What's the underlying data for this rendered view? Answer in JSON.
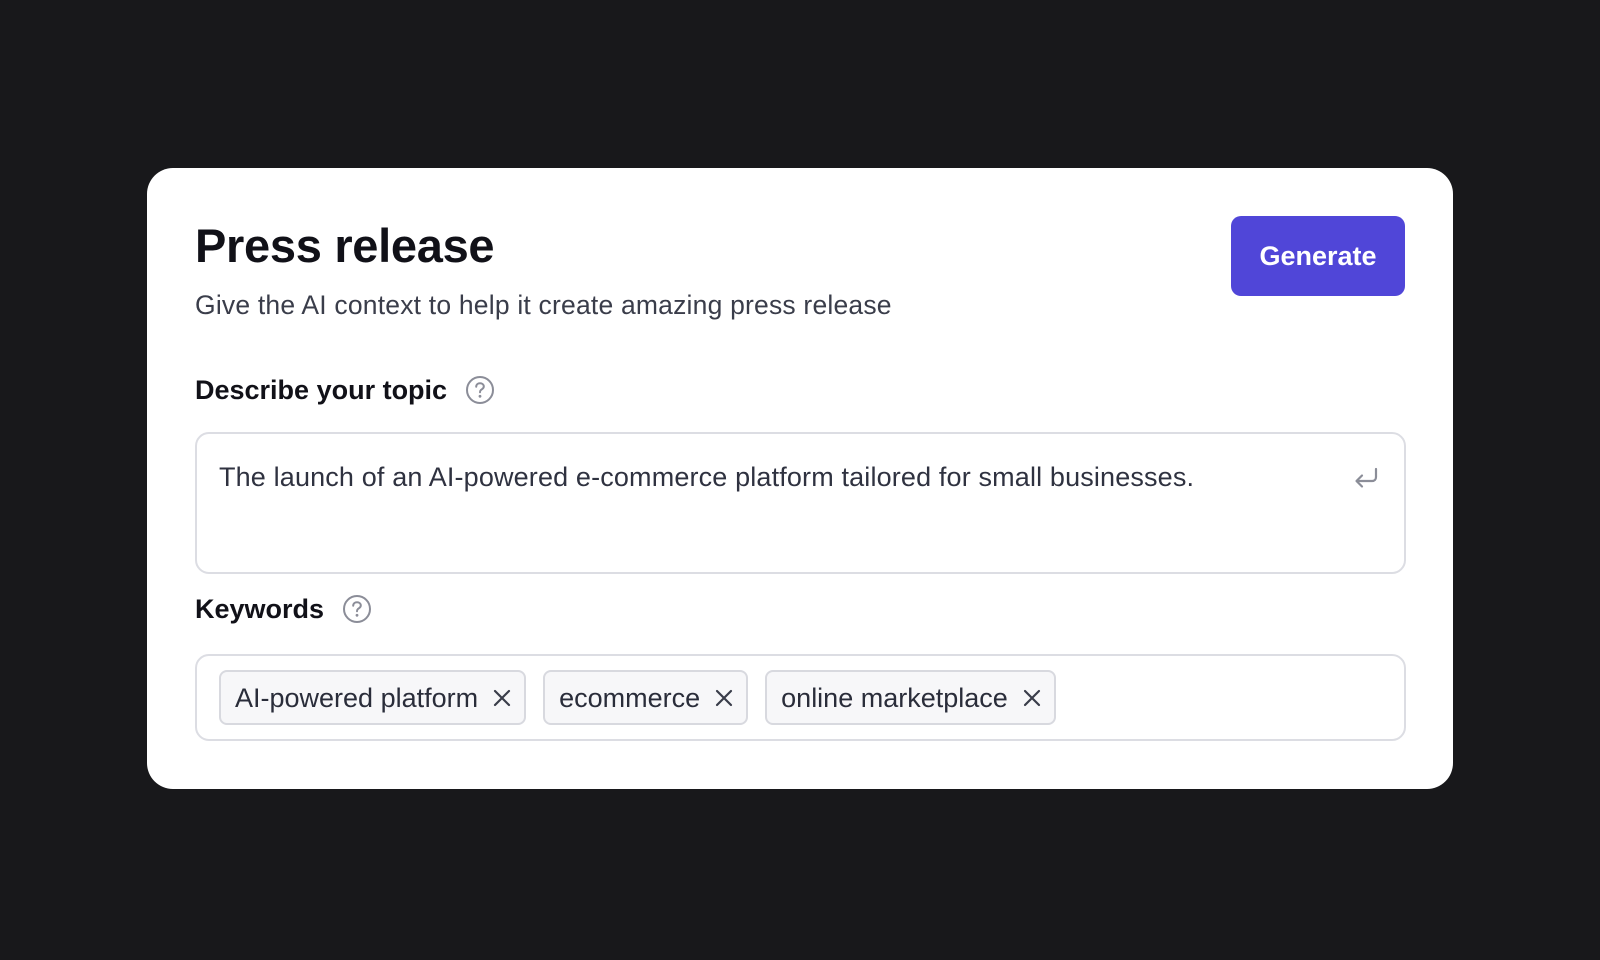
{
  "card": {
    "title": "Press release",
    "subtitle": "Give the AI context to help it create amazing press release",
    "generate_label": "Generate"
  },
  "topic": {
    "label": "Describe your topic",
    "help_icon": "question-circle-icon",
    "value": "The launch of an AI-powered e-commerce platform tailored for small businesses.",
    "submit_icon": "enter-return-icon"
  },
  "keywords": {
    "label": "Keywords",
    "help_icon": "question-circle-icon",
    "tags": [
      {
        "label": "AI-powered platform"
      },
      {
        "label": "ecommerce"
      },
      {
        "label": "online marketplace"
      }
    ],
    "remove_icon": "close-icon"
  },
  "colors": {
    "background": "#18181b",
    "card": "#ffffff",
    "accent": "#5046d8",
    "border": "#dcdde3"
  }
}
